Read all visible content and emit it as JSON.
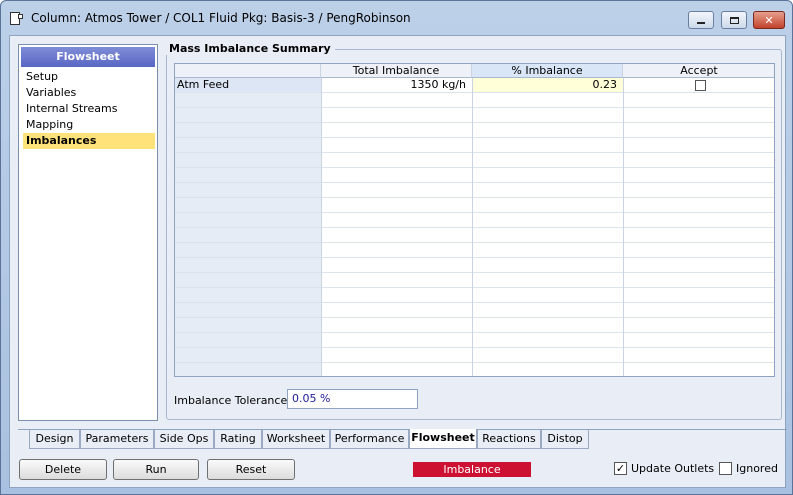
{
  "window": {
    "title": "Column: Atmos Tower / COL1  Fluid Pkg: Basis-3 / PengRobinson",
    "min_icon": "minimize-icon",
    "max_icon": "maximize-icon",
    "close_icon": "close-icon"
  },
  "nav": {
    "header": "Flowsheet",
    "items": [
      {
        "label": "Setup"
      },
      {
        "label": "Variables"
      },
      {
        "label": "Internal Streams"
      },
      {
        "label": "Mapping"
      },
      {
        "label": "Imbalances",
        "selected": true
      }
    ]
  },
  "group": {
    "title": "Mass Imbalance Summary"
  },
  "table": {
    "columns": [
      "Total Imbalance",
      "% Imbalance",
      "Accept"
    ],
    "rows": [
      {
        "name": "Atm Feed",
        "total_imbalance": "1350 kg/h",
        "pct_imbalance": "0.23",
        "accept": false
      }
    ]
  },
  "tolerance": {
    "label": "Imbalance Tolerance",
    "value": "0.05 %"
  },
  "tabs": [
    {
      "label": "Design"
    },
    {
      "label": "Parameters"
    },
    {
      "label": "Side Ops"
    },
    {
      "label": "Rating"
    },
    {
      "label": "Worksheet"
    },
    {
      "label": "Performance"
    },
    {
      "label": "Flowsheet",
      "active": true
    },
    {
      "label": "Reactions"
    },
    {
      "label": "Distop"
    }
  ],
  "buttons": {
    "delete": "Delete",
    "run": "Run",
    "reset": "Reset"
  },
  "status": {
    "text": "Imbalance",
    "color": "#cc1133"
  },
  "options": {
    "update_outlets": {
      "label": "Update Outlets",
      "checked": true
    },
    "ignored": {
      "label": "Ignored",
      "checked": false
    }
  }
}
